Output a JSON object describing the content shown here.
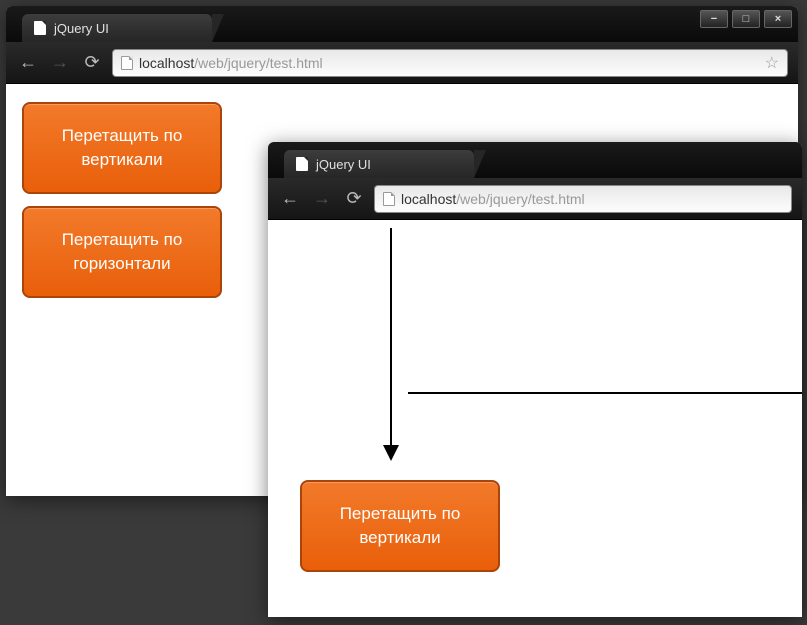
{
  "windows": [
    {
      "tab_title": "jQuery UI",
      "url_host": "localhost",
      "url_path": "/web/jquery/test.html",
      "boxes": [
        {
          "text": "Перетащить по вертикали"
        },
        {
          "text": "Перетащить по горизонтали"
        }
      ]
    },
    {
      "tab_title": "jQuery UI",
      "url_host": "localhost",
      "url_path": "/web/jquery/test.html",
      "boxes": [
        {
          "text": "Перетащить по вертикали"
        }
      ]
    }
  ],
  "window_controls": {
    "min": "−",
    "max": "□",
    "close": "×"
  }
}
